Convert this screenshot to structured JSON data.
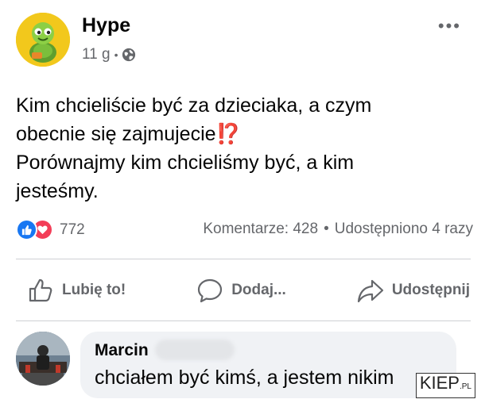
{
  "post": {
    "author": "Hype",
    "time": "11 g",
    "separator": "•",
    "more_label": "•••",
    "text_lines": [
      "Kim chcieliście być za dzieciaka, a czym",
      "obecnie się zajmujecie",
      "Porównajmy kim chcieliśmy być, a kim",
      "jesteśmy."
    ],
    "emoji": "⁉️"
  },
  "stats": {
    "reaction_count": "772",
    "comments": "Komentarze: 428",
    "separator": "•",
    "shares": "Udostępniono 4 razy"
  },
  "actions": {
    "like": "Lubię to!",
    "comment": "Dodaj...",
    "share": "Udostępnij"
  },
  "comment": {
    "author": "Marcin",
    "text": "chciałem być kimś, a jestem nikim"
  },
  "watermark": {
    "main": "KIEP",
    "suffix": ".PL"
  },
  "icons": {
    "avatar": "turtle-avatar-icon",
    "globe": "globe-icon",
    "like_reaction": "like-reaction-icon",
    "love_reaction": "love-reaction-icon",
    "like_action": "thumbs-up-icon",
    "comment_action": "comment-bubble-icon",
    "share_action": "share-arrow-icon"
  },
  "colors": {
    "like_blue": "#1877f2",
    "love_red": "#f33e58",
    "secondary_text": "#65676b",
    "bubble_bg": "#f0f2f5"
  }
}
